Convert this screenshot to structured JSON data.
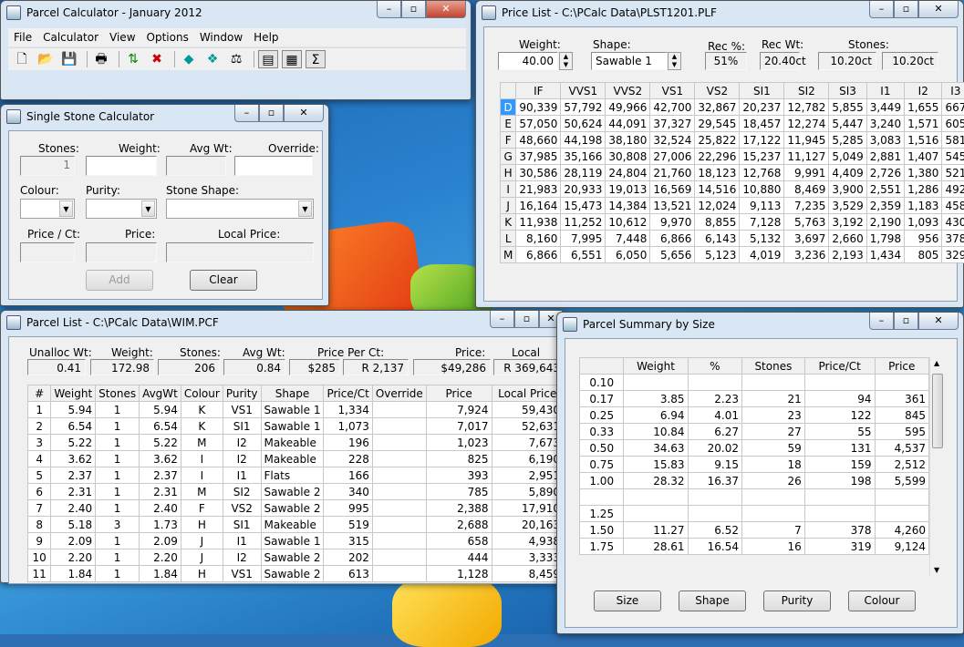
{
  "colors": {
    "selection": "#3399ff",
    "title_bar": "#c9dcf1",
    "desktop": "#2d6fb5"
  },
  "main": {
    "title": "Parcel Calculator - January 2012",
    "menu": [
      "File",
      "Calculator",
      "View",
      "Options",
      "Window",
      "Help"
    ],
    "toolbar_icons": [
      "new-icon",
      "open-icon",
      "save-icon",
      "print-icon",
      "sort-icon",
      "delete-icon",
      "diamond-icon",
      "diamonds-icon",
      "scale-icon",
      "single-calc-icon",
      "pricelist-icon",
      "sum-icon"
    ]
  },
  "single": {
    "title": "Single Stone Calculator",
    "stones_label": "Stones:",
    "stones_value": "1",
    "weight_label": "Weight:",
    "weight_value": "",
    "avg_label": "Avg Wt:",
    "avg_value": "",
    "override_label": "Override:",
    "override_value": "",
    "colour_label": "Colour:",
    "purity_label": "Purity:",
    "shape_label": "Stone Shape:",
    "ppc_label": "Price / Ct:",
    "price_label": "Price:",
    "local_label": "Local Price:",
    "add": "Add",
    "clear": "Clear"
  },
  "pricelist": {
    "title": "Price List - C:\\PCalc Data\\PLST1201.PLF",
    "weight_label": "Weight:",
    "weight_value": "40.00",
    "shape_label": "Shape:",
    "shape_value": "Sawable 1",
    "recpct_label": "Rec %:",
    "recpct_value": "51%",
    "recwt_label": "Rec Wt:",
    "recwt_value": "20.40ct",
    "stones_label": "Stones:",
    "stones_value1": "10.20ct",
    "stones_value2": "10.20ct",
    "columns": [
      "",
      "IF",
      "VVS1",
      "VVS2",
      "VS1",
      "VS2",
      "SI1",
      "SI2",
      "SI3",
      "I1",
      "I2",
      "I3"
    ],
    "rows": [
      [
        "D",
        "90,339",
        "57,792",
        "49,966",
        "42,700",
        "32,867",
        "20,237",
        "12,782",
        "5,855",
        "3,449",
        "1,655",
        "667"
      ],
      [
        "E",
        "57,050",
        "50,624",
        "44,091",
        "37,327",
        "29,545",
        "18,457",
        "12,274",
        "5,447",
        "3,240",
        "1,571",
        "605"
      ],
      [
        "F",
        "48,660",
        "44,198",
        "38,180",
        "32,524",
        "25,822",
        "17,122",
        "11,945",
        "5,285",
        "3,083",
        "1,516",
        "581"
      ],
      [
        "G",
        "37,985",
        "35,166",
        "30,808",
        "27,006",
        "22,296",
        "15,237",
        "11,127",
        "5,049",
        "2,881",
        "1,407",
        "545"
      ],
      [
        "H",
        "30,586",
        "28,119",
        "24,804",
        "21,760",
        "18,123",
        "12,768",
        "9,991",
        "4,409",
        "2,726",
        "1,380",
        "521"
      ],
      [
        "I",
        "21,983",
        "20,933",
        "19,013",
        "16,569",
        "14,516",
        "10,880",
        "8,469",
        "3,900",
        "2,551",
        "1,286",
        "492"
      ],
      [
        "J",
        "16,164",
        "15,473",
        "14,384",
        "13,521",
        "12,024",
        "9,113",
        "7,235",
        "3,529",
        "2,359",
        "1,183",
        "458"
      ],
      [
        "K",
        "11,938",
        "11,252",
        "10,612",
        "9,970",
        "8,855",
        "7,128",
        "5,763",
        "3,192",
        "2,190",
        "1,093",
        "430"
      ],
      [
        "L",
        "8,160",
        "7,995",
        "7,448",
        "6,866",
        "6,143",
        "5,132",
        "3,697",
        "2,660",
        "1,798",
        "956",
        "378"
      ],
      [
        "M",
        "6,866",
        "6,551",
        "6,050",
        "5,656",
        "5,123",
        "4,019",
        "3,236",
        "2,193",
        "1,434",
        "805",
        "329"
      ]
    ]
  },
  "parcel": {
    "title": "Parcel List - C:\\PCalc Data\\WIM.PCF",
    "unalloc_label": "Unalloc Wt:",
    "unalloc_value": "0.41",
    "weight_label": "Weight:",
    "weight_value": "172.98",
    "stones_label": "Stones:",
    "stones_value": "206",
    "avg_label": "Avg Wt:",
    "avg_value": "0.84",
    "ppc_label": "Price Per Ct:",
    "ppc_value1": "$285",
    "ppc_value2": "R  2,137",
    "price_label": "Price:",
    "price_value": "$49,286",
    "local_label": "Local Price:",
    "local_value": "R  369,643",
    "columns": [
      "#",
      "Weight",
      "Stones",
      "AvgWt",
      "Colour",
      "Purity",
      "Shape",
      "Price/Ct",
      "Override",
      "Price",
      "Local Price"
    ],
    "rows": [
      [
        "1",
        "5.94",
        "1",
        "5.94",
        "K",
        "VS1",
        "Sawable 1",
        "1,334",
        "",
        "7,924",
        "59,430"
      ],
      [
        "2",
        "6.54",
        "1",
        "6.54",
        "K",
        "SI1",
        "Sawable 1",
        "1,073",
        "",
        "7,017",
        "52,631"
      ],
      [
        "3",
        "5.22",
        "1",
        "5.22",
        "M",
        "I2",
        "Makeable",
        "196",
        "",
        "1,023",
        "7,673"
      ],
      [
        "4",
        "3.62",
        "1",
        "3.62",
        "I",
        "I2",
        "Makeable",
        "228",
        "",
        "825",
        "6,190"
      ],
      [
        "5",
        "2.37",
        "1",
        "2.37",
        "I",
        "I1",
        "Flats",
        "166",
        "",
        "393",
        "2,951"
      ],
      [
        "6",
        "2.31",
        "1",
        "2.31",
        "M",
        "SI2",
        "Sawable 2",
        "340",
        "",
        "785",
        "5,890"
      ],
      [
        "7",
        "2.40",
        "1",
        "2.40",
        "F",
        "VS2",
        "Sawable 2",
        "995",
        "",
        "2,388",
        "17,910"
      ],
      [
        "8",
        "5.18",
        "3",
        "1.73",
        "H",
        "SI1",
        "Makeable",
        "519",
        "",
        "2,688",
        "20,163"
      ],
      [
        "9",
        "2.09",
        "1",
        "2.09",
        "J",
        "I1",
        "Sawable 1",
        "315",
        "",
        "658",
        "4,938"
      ],
      [
        "10",
        "2.20",
        "1",
        "2.20",
        "J",
        "I2",
        "Sawable 2",
        "202",
        "",
        "444",
        "3,333"
      ],
      [
        "11",
        "1.84",
        "1",
        "1.84",
        "H",
        "VS1",
        "Sawable 2",
        "613",
        "",
        "1,128",
        "8,459"
      ]
    ]
  },
  "summary": {
    "title": "Parcel Summary by Size",
    "columns": [
      "",
      "Weight",
      "%",
      "Stones",
      "Price/Ct",
      "Price"
    ],
    "rows": [
      [
        "0.10",
        "",
        "",
        "",
        "",
        ""
      ],
      [
        "0.17",
        "3.85",
        "2.23",
        "21",
        "94",
        "361"
      ],
      [
        "0.25",
        "6.94",
        "4.01",
        "23",
        "122",
        "845"
      ],
      [
        "0.33",
        "10.84",
        "6.27",
        "27",
        "55",
        "595"
      ],
      [
        "0.50",
        "34.63",
        "20.02",
        "59",
        "131",
        "4,537"
      ],
      [
        "0.75",
        "15.83",
        "9.15",
        "18",
        "159",
        "2,512"
      ],
      [
        "1.00",
        "28.32",
        "16.37",
        "26",
        "198",
        "5,599"
      ],
      [
        "",
        "",
        "",
        "",
        "",
        ""
      ],
      [
        "1.25",
        "",
        "",
        "",
        "",
        ""
      ],
      [
        "1.50",
        "11.27",
        "6.52",
        "7",
        "378",
        "4,260"
      ],
      [
        "1.75",
        "28.61",
        "16.54",
        "16",
        "319",
        "9,124"
      ]
    ],
    "buttons": [
      "Size",
      "Shape",
      "Purity",
      "Colour"
    ]
  }
}
